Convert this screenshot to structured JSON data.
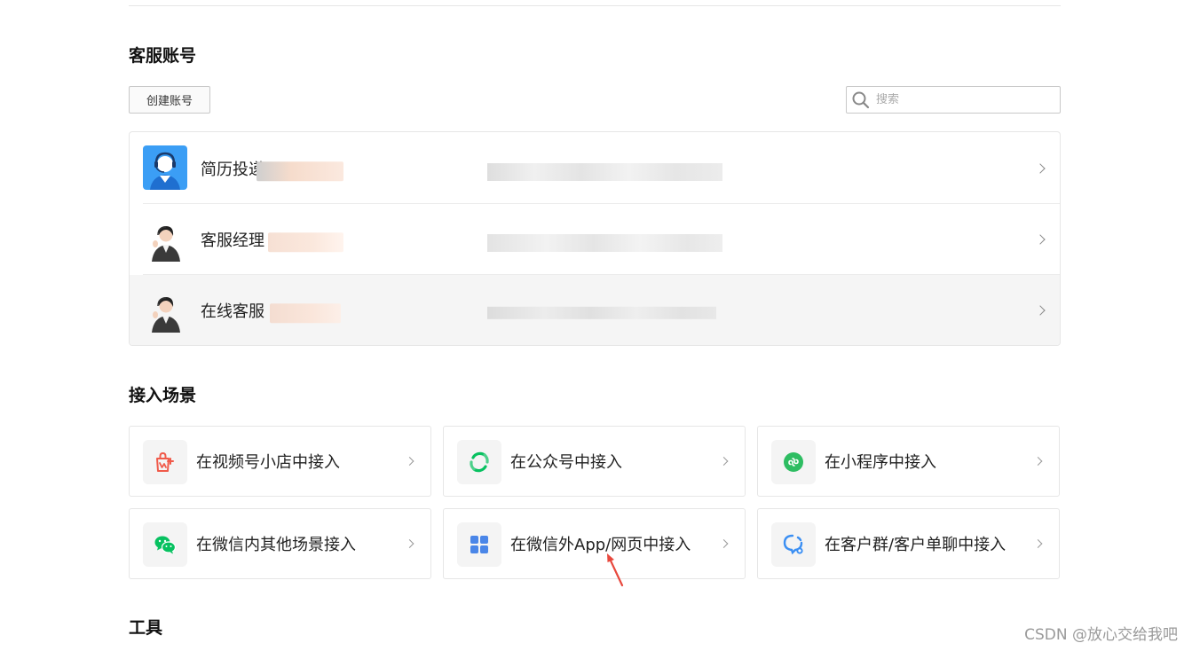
{
  "accounts_section": {
    "title": "客服账号",
    "create_button": "创建账号",
    "search_placeholder": "搜索",
    "items": [
      {
        "name": "简历投递"
      },
      {
        "name": "客服经理"
      },
      {
        "name": "在线客服"
      }
    ]
  },
  "scenes_section": {
    "title": "接入场景",
    "cards": [
      {
        "label": "在视频号小店中接入",
        "icon": "shop-bag-icon"
      },
      {
        "label": "在公众号中接入",
        "icon": "official-account-icon"
      },
      {
        "label": "在小程序中接入",
        "icon": "mini-program-icon"
      },
      {
        "label": "在微信内其他场景接入",
        "icon": "wechat-icon"
      },
      {
        "label": "在微信外App/网页中接入",
        "icon": "app-grid-icon"
      },
      {
        "label": "在客户群/客户单聊中接入",
        "icon": "chat-bubble-icon"
      }
    ]
  },
  "tools_section": {
    "title": "工具"
  },
  "watermark": "CSDN @放心交给我吧",
  "colors": {
    "shop_red": "#f05a4a",
    "wechat_green": "#07c160",
    "app_blue": "#4a86e8",
    "arrow_red": "#e8483d",
    "avatar_blue": "#3b9ef5"
  }
}
